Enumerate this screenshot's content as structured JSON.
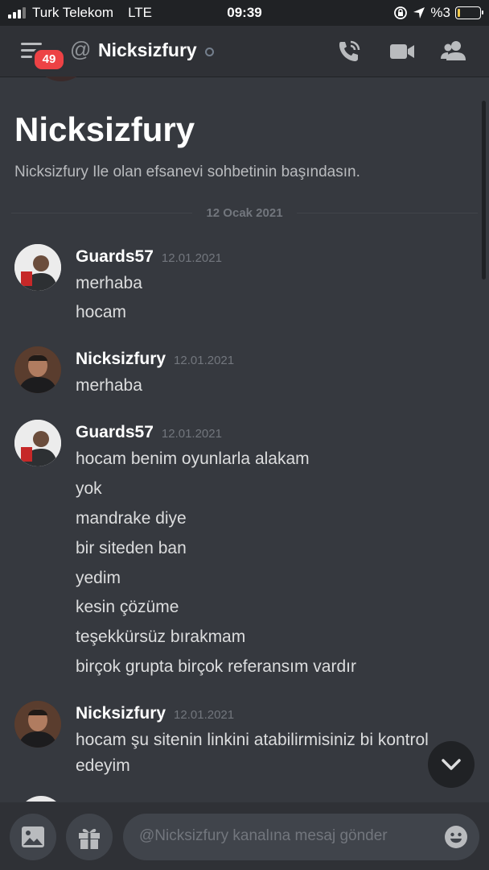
{
  "status_bar": {
    "carrier": "Turk Telekom",
    "network": "LTE",
    "time": "09:39",
    "battery_text": "%3"
  },
  "header": {
    "badge_count": "49",
    "channel_name": "Nicksizfury",
    "icons": [
      "menu-icon",
      "at-icon",
      "phone-icon",
      "video-icon",
      "members-icon"
    ]
  },
  "chat": {
    "welcome_title": "Nicksizfury",
    "welcome_subtitle": "Nicksizfury Ile olan efsanevi sohbetinin başındasın.",
    "date_divider": "12 Ocak 2021",
    "messages": [
      {
        "user": "Guards57",
        "time": "12.01.2021",
        "lines": [
          "merhaba",
          "hocam"
        ]
      },
      {
        "user": "Nicksizfury",
        "time": "12.01.2021",
        "lines": [
          "merhaba"
        ]
      },
      {
        "user": "Guards57",
        "time": "12.01.2021",
        "lines": [
          "hocam benim oyunlarla alakam",
          "yok",
          "mandrake diye",
          "bir siteden ban",
          "yedim",
          "kesin çözüme",
          "teşekkürsüz bırakmam",
          "birçok grupta birçok referansım vardır"
        ]
      },
      {
        "user": "Nicksizfury",
        "time": "12.01.2021",
        "lines": [
          "hocam şu sitenin linkini atabilirmisiniz bi kontrol",
          "edeyim"
        ]
      }
    ]
  },
  "input": {
    "placeholder": "@Nicksizfury kanalına mesaj gönder"
  },
  "colors": {
    "background": "#36393f",
    "header": "#2f3136",
    "badge": "#ed4245",
    "battery_low": "#f2c94c"
  }
}
